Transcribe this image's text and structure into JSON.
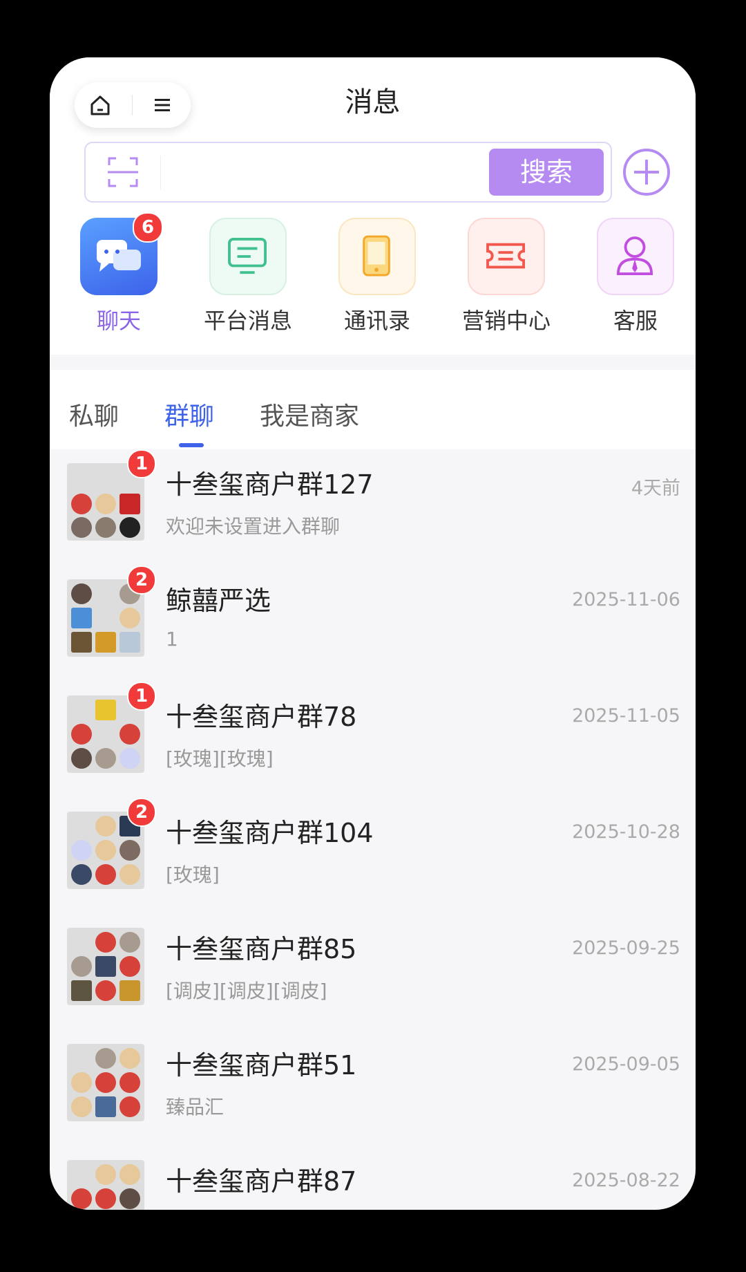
{
  "header": {
    "title": "消息",
    "search_button": "搜索",
    "search_value": ""
  },
  "quick_actions": [
    {
      "label": "聊天",
      "badge": "6",
      "icon": "chat-icon",
      "color": "#4b7cf4",
      "active": true
    },
    {
      "label": "平台消息",
      "icon": "platform-message-icon",
      "color": "#3fc08e"
    },
    {
      "label": "通讯录",
      "icon": "contacts-icon",
      "color": "#f2a82b"
    },
    {
      "label": "营销中心",
      "icon": "coupon-icon",
      "color": "#f2584d"
    },
    {
      "label": "客服",
      "icon": "customer-service-icon",
      "color": "#c24ee0"
    }
  ],
  "tabs": [
    {
      "label": "私聊"
    },
    {
      "label": "群聊",
      "active": true
    },
    {
      "label": "我是商家"
    }
  ],
  "chats": [
    {
      "name": "十叁玺商户群127",
      "message": "欢迎未设置进入群聊",
      "time": "4天前",
      "badge": "1"
    },
    {
      "name": "鲸囍严选",
      "message": "1",
      "time": "2025-11-06",
      "badge": "2"
    },
    {
      "name": "十叁玺商户群78",
      "message": "[玫瑰][玫瑰]",
      "time": "2025-11-05",
      "badge": "1"
    },
    {
      "name": "十叁玺商户群104",
      "message": "[玫瑰]",
      "time": "2025-10-28",
      "badge": "2"
    },
    {
      "name": "十叁玺商户群85",
      "message": "[调皮][调皮][调皮]",
      "time": "2025-09-25"
    },
    {
      "name": "十叁玺商户群51",
      "message": "臻品汇",
      "time": "2025-09-05"
    },
    {
      "name": "十叁玺商户群87",
      "message": "",
      "time": "2025-08-22"
    }
  ]
}
